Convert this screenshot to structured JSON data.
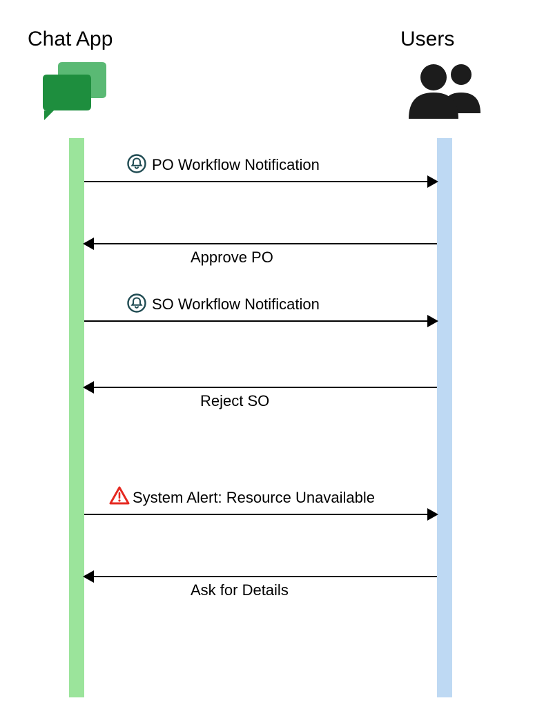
{
  "actors": {
    "left": {
      "label": "Chat App"
    },
    "right": {
      "label": "Users"
    }
  },
  "messages": {
    "m1": {
      "label": "PO Workflow Notification",
      "icon": "bell"
    },
    "m2": {
      "label": "Approve PO"
    },
    "m3": {
      "label": "SO Workflow Notification",
      "icon": "bell"
    },
    "m4": {
      "label": "Reject SO"
    },
    "m5": {
      "label": "System Alert: Resource Unavailable",
      "icon": "alert"
    },
    "m6": {
      "label": "Ask for Details"
    }
  },
  "colors": {
    "leftLifeline": "#9be49b",
    "rightLifeline": "#bed9f3",
    "bellIcon": "#1f4b52",
    "alertIcon": "#e52820",
    "chatBubbleBack": "#5ab974",
    "chatBubbleFront": "#1e8e3e",
    "usersIcon": "#1c1c1c"
  }
}
